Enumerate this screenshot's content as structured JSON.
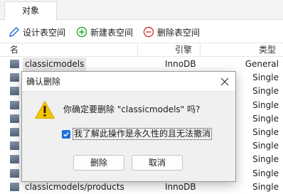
{
  "tabs": [
    {
      "label": "对象"
    }
  ],
  "toolbar": {
    "design_label": "设计表空间",
    "new_label": "新建表空间",
    "delete_label": "删除表空间"
  },
  "grid": {
    "headers": {
      "name": "名",
      "engine": "引擎",
      "type": "类型"
    },
    "rows": [
      {
        "name": "classicmodels",
        "engine": "InnoDB",
        "type": "General"
      },
      {
        "name": "",
        "engine": "",
        "type": "Single"
      },
      {
        "name": "",
        "engine": "",
        "type": "Single"
      },
      {
        "name": "",
        "engine": "",
        "type": "Single"
      },
      {
        "name": "",
        "engine": "",
        "type": "Single"
      },
      {
        "name": "",
        "engine": "",
        "type": "Single"
      },
      {
        "name": "",
        "engine": "",
        "type": "Single"
      },
      {
        "name": "",
        "engine": "",
        "type": "Single"
      },
      {
        "name": "",
        "engine": "",
        "type": "Single"
      },
      {
        "name": "classicmodels/products",
        "engine": "InnoDB",
        "type": "Single"
      }
    ]
  },
  "dialog": {
    "title": "确认删除",
    "message": "你确定要删除 \"classicmodels\" 吗?",
    "checkbox_label": "我了解此操作是永久性的且无法撤消",
    "checkbox_checked": true,
    "delete_button": "删除",
    "cancel_button": "取消"
  },
  "colors": {
    "accent": "#1e6fd9",
    "add_icon": "#2aa52a",
    "delete_icon": "#d93a3a",
    "warning": "#f5c400"
  },
  "icons": {
    "design": "pencil-icon",
    "new": "plus-circle-icon",
    "delete": "minus-circle-icon",
    "warning": "warning-icon",
    "close": "close-icon",
    "table": "table-icon"
  }
}
